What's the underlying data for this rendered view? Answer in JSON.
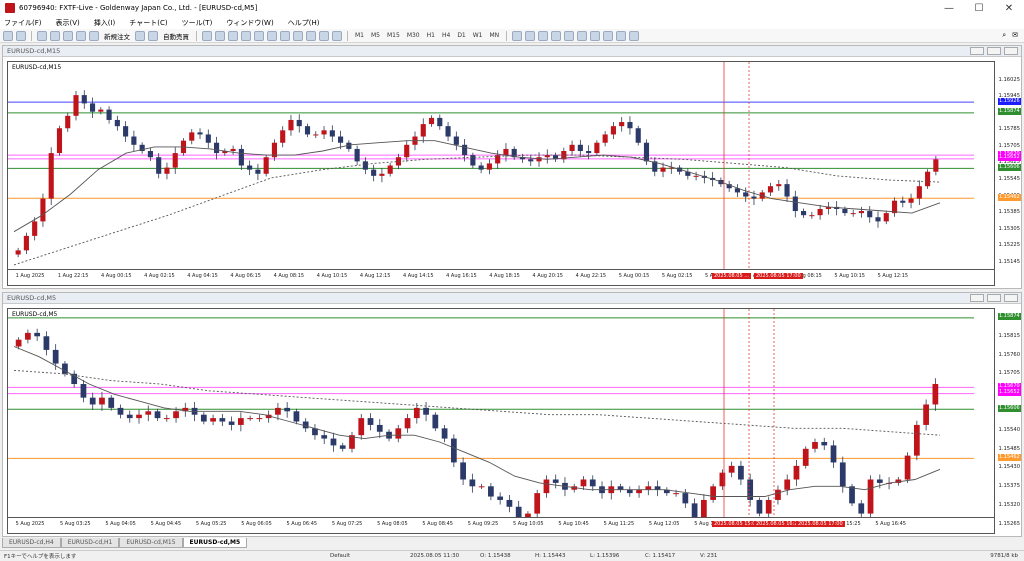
{
  "title": "60796940: FXTF-Live - Goldenway Japan Co., Ltd. - [EURUSD-cd,M5]",
  "menu": [
    "ファイル(F)",
    "表示(V)",
    "挿入(I)",
    "チャート(C)",
    "ツール(T)",
    "ウィンドウ(W)",
    "ヘルプ(H)"
  ],
  "toolbar": {
    "new_order": "新規注文",
    "auto_trade": "自動売買",
    "timeframes": [
      "M1",
      "M5",
      "M15",
      "M30",
      "H1",
      "H4",
      "D1",
      "W1",
      "MN"
    ]
  },
  "chart_data": [
    {
      "name": "upper",
      "title": "EURUSD-cd,M15",
      "window_label": "EURUSD-cd,M15",
      "type": "candlestick",
      "ylim": [
        1.1512,
        1.1612
      ],
      "yticks": [
        "1.16025",
        "1.15945",
        "1.15865",
        "1.15785",
        "1.15705",
        "1.15625",
        "1.15545",
        "1.15465",
        "1.15385",
        "1.15305",
        "1.15225",
        "1.15145"
      ],
      "xticks": [
        "1 Aug 2025",
        "1 Aug 22:15",
        "4 Aug 00:15",
        "4 Aug 02:15",
        "4 Aug 04:15",
        "4 Aug 06:15",
        "4 Aug 08:15",
        "4 Aug 10:15",
        "4 Aug 12:15",
        "4 Aug 14:15",
        "4 Aug 16:15",
        "4 Aug 18:15",
        "4 Aug 20:15",
        "4 Aug 22:15",
        "5 Aug 00:15",
        "5 Aug 02:15",
        "5 Aug 04:15",
        "5 Aug 06:15",
        "5 Aug 08:15",
        "5 Aug 10:15",
        "5 Aug 12:15"
      ],
      "x_highlights": [
        "2025.08.05 ...",
        "2025.08.05 17:00"
      ],
      "price_tags": [
        {
          "value": 1.15926,
          "label": "1.15926",
          "color": "#1c1cff"
        },
        {
          "value": 1.15874,
          "label": "1.15874",
          "color": "#2f8f2f"
        },
        {
          "value": 1.1567,
          "label": "1.15670",
          "color": "#ff00ff"
        },
        {
          "value": 1.15652,
          "label": "1.15652",
          "color": "#ff00ff"
        },
        {
          "value": 1.15606,
          "label": "1.15606",
          "color": "#2f8f2f"
        },
        {
          "value": 1.15462,
          "label": "1.15462",
          "color": "#ff9a2e"
        }
      ],
      "hlines": [
        {
          "value": 1.15926,
          "color": "#4040ff"
        },
        {
          "value": 1.15874,
          "color": "#2f8f2f"
        },
        {
          "value": 1.1567,
          "color": "#ff66ff"
        },
        {
          "value": 1.15652,
          "color": "#ff66ff"
        },
        {
          "value": 1.15606,
          "color": "#2f8f2f"
        },
        {
          "value": 1.15462,
          "color": "#ff9a2e"
        }
      ],
      "close": [
        1.1521,
        1.1528,
        1.1535,
        1.1546,
        1.1568,
        1.158,
        1.1586,
        1.1596,
        1.1592,
        1.1588,
        1.1589,
        1.1584,
        1.1581,
        1.1576,
        1.1572,
        1.1569,
        1.1566,
        1.1558,
        1.1561,
        1.1568,
        1.1574,
        1.1578,
        1.1577,
        1.1573,
        1.1568,
        1.1569,
        1.157,
        1.1562,
        1.156,
        1.1558,
        1.1566,
        1.1573,
        1.1579,
        1.1584,
        1.1581,
        1.1577,
        1.1577,
        1.1579,
        1.1576,
        1.1573,
        1.157,
        1.1564,
        1.156,
        1.1557,
        1.1558,
        1.1562,
        1.1566,
        1.1572,
        1.1576,
        1.1582,
        1.1585,
        1.1581,
        1.1576,
        1.1572,
        1.1567,
        1.1562,
        1.156,
        1.1563,
        1.1567,
        1.157,
        1.1566,
        1.1565,
        1.1564,
        1.1566,
        1.1567,
        1.1565,
        1.1569,
        1.1572,
        1.1569,
        1.1568,
        1.1573,
        1.1577,
        1.1581,
        1.1583,
        1.158,
        1.1573,
        1.1564,
        1.1559,
        1.1561,
        1.1561,
        1.1559,
        1.1557,
        1.1557,
        1.1556,
        1.1555,
        1.1553,
        1.1551,
        1.1549,
        1.1547,
        1.1546,
        1.1549,
        1.1552,
        1.1553,
        1.1547,
        1.154,
        1.1538,
        1.1538,
        1.1541,
        1.1542,
        1.1541,
        1.1539,
        1.1539,
        1.154,
        1.1537,
        1.1535,
        1.1539,
        1.1545,
        1.1544,
        1.1546,
        1.1552,
        1.1559,
        1.1565
      ],
      "ma": [
        1.153,
        1.1538,
        1.1548,
        1.156,
        1.1568,
        1.1571,
        1.1571,
        1.157,
        1.1568,
        1.1567,
        1.1567,
        1.1569,
        1.1572,
        1.1573,
        1.1574,
        1.1574,
        1.1571,
        1.1568,
        1.1566,
        1.1565,
        1.1566,
        1.1567,
        1.1566,
        1.1563,
        1.1559,
        1.1555,
        1.155,
        1.1546,
        1.1544,
        1.1542,
        1.1541,
        1.154,
        1.1539,
        1.1544
      ],
      "ma2": [
        1.1514,
        1.1522,
        1.153,
        1.1538,
        1.1547,
        1.1556,
        1.156,
        1.1563,
        1.1565,
        1.1566,
        1.1567,
        1.1567,
        1.1566,
        1.1565,
        1.1563,
        1.1561,
        1.1557,
        1.1555,
        1.1554
      ]
    },
    {
      "name": "lower",
      "title": "EURUSD-cd,M5",
      "window_label": "EURUSD-cd,M5",
      "type": "candlestick",
      "ylim": [
        1.1529,
        1.159
      ],
      "yticks": [
        "1.15815",
        "1.15760",
        "1.15705",
        "1.15650",
        "1.15595",
        "1.15540",
        "1.15485",
        "1.15430",
        "1.15375",
        "1.15320",
        "1.15265"
      ],
      "xticks": [
        "5 Aug 2025",
        "5 Aug 03:25",
        "5 Aug 04:05",
        "5 Aug 04:45",
        "5 Aug 05:25",
        "5 Aug 06:05",
        "5 Aug 06:45",
        "5 Aug 07:25",
        "5 Aug 08:05",
        "5 Aug 08:45",
        "5 Aug 09:25",
        "5 Aug 10:05",
        "5 Aug 10:45",
        "5 Aug 11:25",
        "5 Aug 12:05",
        "5 Aug 12:45",
        "5 Aug 13:25",
        "5 Aug 14:05",
        "5 Aug 15:25",
        "5 Aug 16:45"
      ],
      "x_highlights": [
        "2025.08.05 15:00",
        "2025.08.05 16:25",
        "2025.08.05 17:00"
      ],
      "price_tags": [
        {
          "value": 1.15874,
          "label": "1.15874",
          "color": "#2f8f2f"
        },
        {
          "value": 1.1567,
          "label": "1.15670",
          "color": "#ff00ff"
        },
        {
          "value": 1.15652,
          "label": "1.15652",
          "color": "#ff00ff"
        },
        {
          "value": 1.15606,
          "label": "1.15606",
          "color": "#2f8f2f"
        },
        {
          "value": 1.15462,
          "label": "1.15462",
          "color": "#ff9a2e"
        }
      ],
      "hlines": [
        {
          "value": 1.15874,
          "color": "#2f8f2f"
        },
        {
          "value": 1.1567,
          "color": "#ff66ff"
        },
        {
          "value": 1.15652,
          "color": "#ff66ff"
        },
        {
          "value": 1.15606,
          "color": "#2f8f2f"
        },
        {
          "value": 1.15462,
          "color": "#ff9a2e"
        }
      ],
      "close": [
        1.1581,
        1.1583,
        1.1582,
        1.1578,
        1.1574,
        1.1571,
        1.1568,
        1.1564,
        1.1562,
        1.1564,
        1.1561,
        1.1559,
        1.1558,
        1.1559,
        1.156,
        1.1558,
        1.1558,
        1.156,
        1.1561,
        1.1559,
        1.1557,
        1.1558,
        1.1557,
        1.1556,
        1.1558,
        1.1558,
        1.1558,
        1.1559,
        1.1561,
        1.156,
        1.1557,
        1.1555,
        1.1553,
        1.1552,
        1.155,
        1.1549,
        1.1553,
        1.1558,
        1.1556,
        1.1554,
        1.1552,
        1.1555,
        1.1558,
        1.1561,
        1.1559,
        1.1555,
        1.1552,
        1.1545,
        1.154,
        1.1538,
        1.1538,
        1.1535,
        1.1534,
        1.1532,
        1.1528,
        1.153,
        1.1536,
        1.154,
        1.1539,
        1.1537,
        1.1538,
        1.154,
        1.1538,
        1.1536,
        1.1538,
        1.1537,
        1.1536,
        1.1537,
        1.1538,
        1.1537,
        1.1536,
        1.1536,
        1.1533,
        1.1529,
        1.1534,
        1.1538,
        1.1542,
        1.1544,
        1.154,
        1.1534,
        1.153,
        1.1534,
        1.1537,
        1.154,
        1.1544,
        1.1549,
        1.1551,
        1.155,
        1.1545,
        1.1538,
        1.1533,
        1.153,
        1.154,
        1.1539,
        1.1539,
        1.154,
        1.1547,
        1.1556,
        1.1562,
        1.1568
      ],
      "ma": [
        1.1579,
        1.1576,
        1.1572,
        1.1568,
        1.1565,
        1.1563,
        1.1561,
        1.156,
        1.156,
        1.156,
        1.1559,
        1.1557,
        1.1555,
        1.1553,
        1.1552,
        1.1553,
        1.1553,
        1.1551,
        1.1548,
        1.1545,
        1.1541,
        1.1539,
        1.1538,
        1.1537,
        1.1537,
        1.1537,
        1.1537,
        1.1536,
        1.1535,
        1.1535,
        1.1535,
        1.1537,
        1.1538,
        1.1538,
        1.1537,
        1.1539,
        1.154,
        1.1543
      ],
      "ma2": [
        1.1572,
        1.1571,
        1.1569,
        1.1568,
        1.1566,
        1.1565,
        1.1564,
        1.1563,
        1.1562,
        1.1561,
        1.156,
        1.1559,
        1.1559,
        1.1558,
        1.1557,
        1.1556,
        1.1555,
        1.1555,
        1.1554,
        1.1553
      ]
    }
  ],
  "tabs": [
    "EURUSD-cd,H4",
    "EURUSD-cd,H1",
    "EURUSD-cd,M15",
    "EURUSD-cd,M5"
  ],
  "status": {
    "help": "F1キーでヘルプを表示します",
    "profile": "Default",
    "datetime": "2025.08.05 11:30",
    "open": "O: 1.15438",
    "high": "H: 1.15443",
    "low": "L: 1.15396",
    "close": "C: 1.15417",
    "volume": "V: 231",
    "traffic": "9781/8 kb"
  }
}
